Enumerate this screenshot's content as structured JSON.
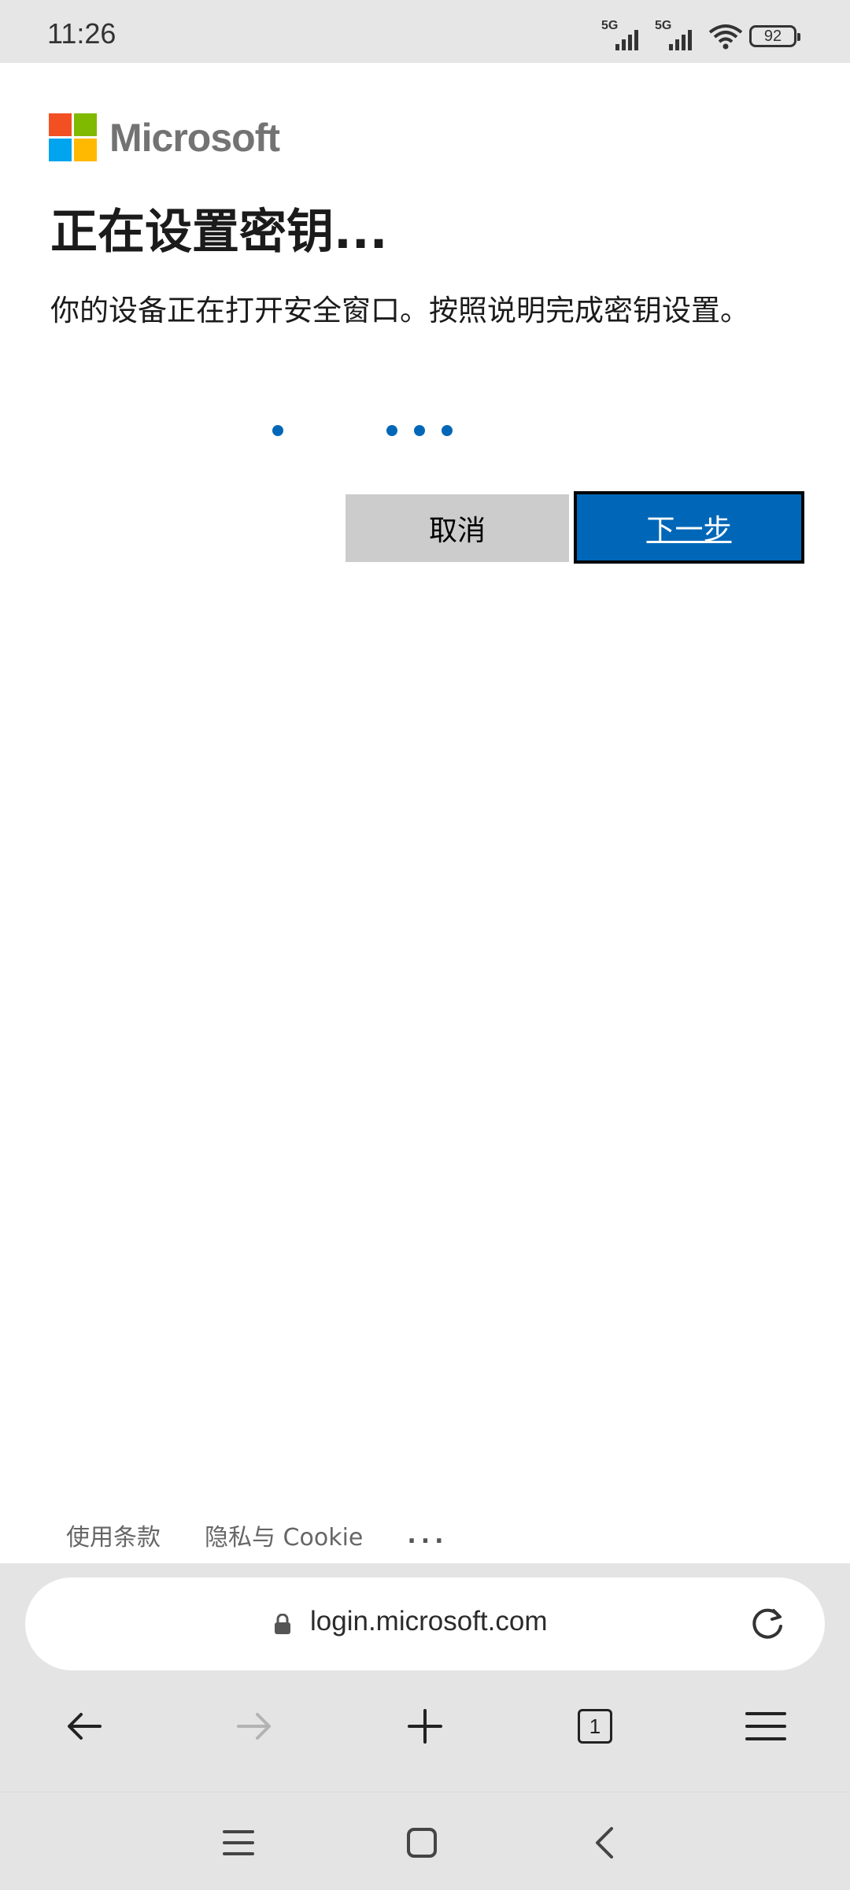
{
  "status_bar": {
    "time": "11:26",
    "network_1": "5G",
    "network_2": "5G",
    "battery": "92"
  },
  "brand": {
    "name": "Microsoft",
    "logo_colors": [
      "#f25022",
      "#7fba00",
      "#00a4ef",
      "#ffb900"
    ]
  },
  "page": {
    "title": "正在设置密钥...",
    "description": "你的设备正在打开安全窗口。按照说明完成密钥设置。",
    "loading_indicator": "dots"
  },
  "buttons": {
    "cancel": "取消",
    "next": "下一步"
  },
  "footer": {
    "terms": "使用条款",
    "privacy": "隐私与 Cookie",
    "more": "..."
  },
  "browser": {
    "url": "login.microsoft.com",
    "tab_count": "1",
    "icons": [
      "back-icon",
      "forward-icon",
      "new-tab-icon",
      "tabs-icon",
      "menu-icon",
      "reload-icon",
      "lock-icon"
    ]
  },
  "system_nav": {
    "icons": [
      "recents-icon",
      "home-icon",
      "back-icon"
    ]
  },
  "colors": {
    "accent": "#0067b8",
    "cancel_bg": "#cccccc"
  }
}
